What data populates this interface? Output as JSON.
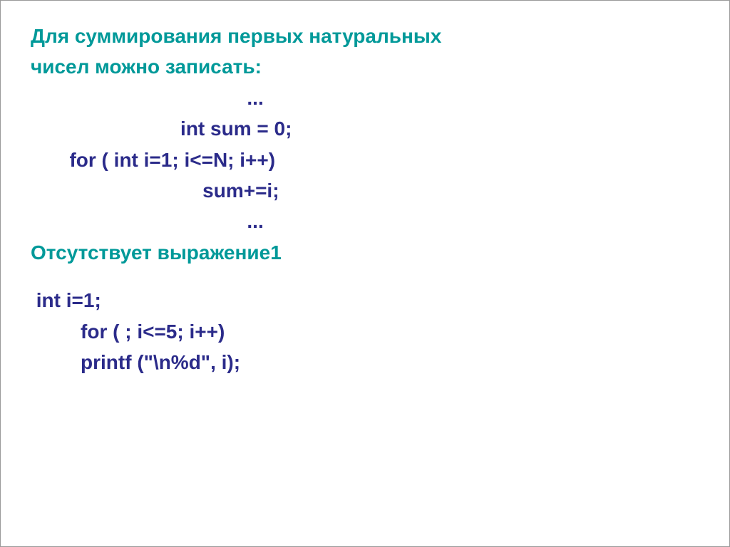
{
  "heading": {
    "line1": "Для суммирования первых натуральных",
    "line2": "чисел можно записать:"
  },
  "code1": {
    "l1": "                                       ...",
    "l2": "                           int sum = 0;",
    "l3": "       for ( int i=1; i<=N; i++)",
    "l4": "                               sum+=i;",
    "l5": "                                       ..."
  },
  "subheading": "Отсутствует выражение1",
  "code2": {
    "l1": " int i=1;",
    "l2": "         for ( ; i<=5; i++)",
    "l3": "         printf (\"\\n%d\", i);"
  }
}
